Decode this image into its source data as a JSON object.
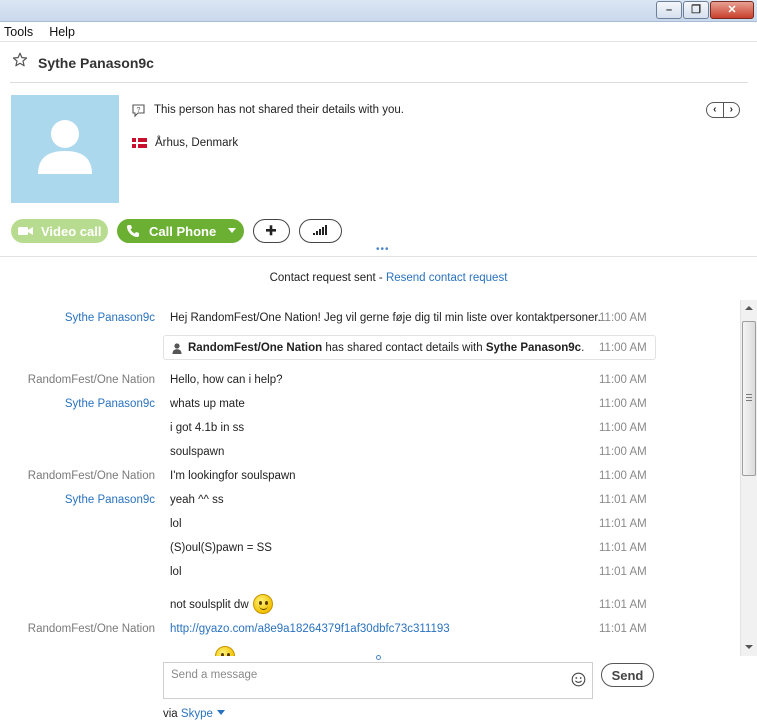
{
  "window": {
    "minimize_glyph": "–",
    "maximize_glyph": "❐",
    "close_glyph": "✕"
  },
  "menu": [
    "Tools",
    "Help"
  ],
  "contact": {
    "name": "Sythe Panason9c",
    "details_notice": "This person has not shared their details with you.",
    "location": "Århus, Denmark",
    "nav_prev": "‹",
    "nav_next": "›"
  },
  "actions": {
    "video_call": "Video call",
    "call_phone": "Call Phone",
    "more_dots": "•••"
  },
  "request": {
    "text": "Contact request sent - ",
    "link": "Resend contact request"
  },
  "shared": {
    "sender": "RandomFest/One Nation",
    "middle": " has shared contact details with ",
    "target": "Sythe Panason9c",
    "end": ".",
    "time": "11:00 AM"
  },
  "messages": [
    {
      "sender": "Sythe Panason9c",
      "sender_color": "blue",
      "text": "Hej RandomFest/One Nation! Jeg vil gerne føje dig til min liste over kontaktpersoner.",
      "time": "11:00 AM"
    },
    {
      "sender": "RandomFest/One Nation",
      "sender_color": "gray",
      "text": "Hello, how can i help?",
      "time": "11:00 AM"
    },
    {
      "sender": "Sythe Panason9c",
      "sender_color": "blue",
      "text": "whats up mate",
      "time": "11:00 AM"
    },
    {
      "sender": "",
      "sender_color": "blue",
      "text": "i got 4.1b in ss",
      "time": "11:00 AM"
    },
    {
      "sender": "",
      "sender_color": "blue",
      "text": "soulspawn",
      "time": "11:00 AM"
    },
    {
      "sender": "RandomFest/One Nation",
      "sender_color": "gray",
      "text": "I'm lookingfor soulspawn",
      "time": "11:00 AM"
    },
    {
      "sender": "Sythe Panason9c",
      "sender_color": "blue",
      "text": "yeah ^^ ss",
      "time": "11:01 AM"
    },
    {
      "sender": "",
      "sender_color": "blue",
      "text": "lol",
      "time": "11:01 AM"
    },
    {
      "sender": "",
      "sender_color": "blue",
      "text": "(S)oul(S)pawn = SS",
      "time": "11:01 AM"
    },
    {
      "sender": "",
      "sender_color": "blue",
      "text": "lol",
      "time": "11:01 AM"
    },
    {
      "sender": "",
      "sender_color": "blue",
      "text": "not soulsplit dw",
      "time": "11:01 AM",
      "emoji": "smile-emoji"
    },
    {
      "sender": "RandomFest/One Nation",
      "sender_color": "gray",
      "text": "http://gyazo.com/a8e9a18264379f1af30dbfc73c311193",
      "time": "11:01 AM",
      "is_link": true
    }
  ],
  "compose": {
    "placeholder": "Send a message",
    "send_label": "Send",
    "via_text": "via ",
    "via_link": "Skype"
  },
  "colors": {
    "accent_blue": "#2a72bf",
    "call_green": "#6cb033",
    "video_green_disabled": "#b8dc8f",
    "avatar_bg": "#acd8ee"
  }
}
